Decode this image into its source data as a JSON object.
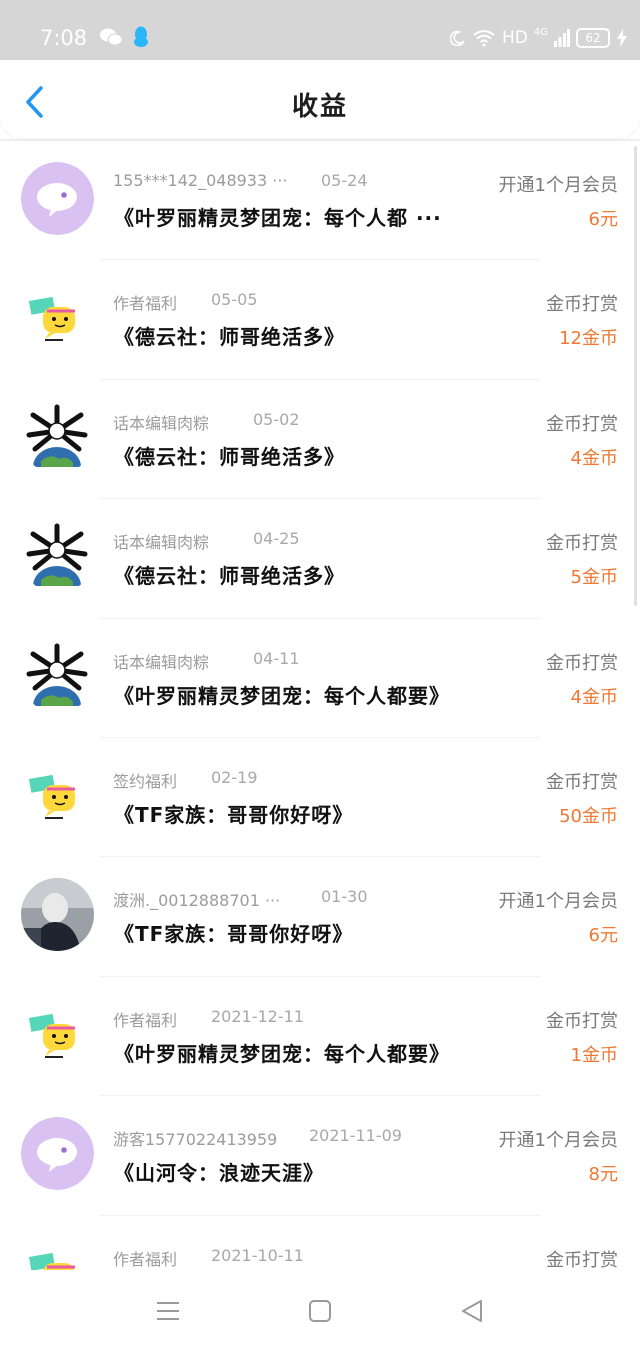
{
  "status_bar": {
    "time": "7:08",
    "hd": "HD",
    "network": "4G",
    "battery": "62",
    "icons": [
      "wechat-icon",
      "qq-icon",
      "moon-icon",
      "wifi-icon",
      "signal-icon",
      "battery-icon",
      "charging-icon"
    ]
  },
  "header": {
    "title": "收益",
    "back_icon": "chevron-left-icon"
  },
  "colors": {
    "accent": "#2196F3",
    "amount": "#F07832",
    "status_bar_bg": "#D6D6D6"
  },
  "records": [
    {
      "user": "155***142_048933 ···",
      "date": "05-24",
      "type": "开通1个月会员",
      "book": "《叶罗丽精灵梦团宠：每个人都 ···",
      "amount": "6元",
      "avatar": "chat-bubble-avatar"
    },
    {
      "user": "作者福利",
      "date": "05-05",
      "type": "金币打赏",
      "book": "《德云社：师哥绝活多》",
      "amount": "12金币",
      "avatar": "yellow-face-avatar"
    },
    {
      "user": "话本编辑肉粽",
      "date": "05-02",
      "type": "金币打赏",
      "book": "《德云社：师哥绝活多》",
      "amount": "4金币",
      "avatar": "earth-cartoon-avatar"
    },
    {
      "user": "话本编辑肉粽",
      "date": "04-25",
      "type": "金币打赏",
      "book": "《德云社：师哥绝活多》",
      "amount": "5金币",
      "avatar": "earth-cartoon-avatar"
    },
    {
      "user": "话本编辑肉粽",
      "date": "04-11",
      "type": "金币打赏",
      "book": "《叶罗丽精灵梦团宠：每个人都要》",
      "amount": "4金币",
      "avatar": "earth-cartoon-avatar"
    },
    {
      "user": "签约福利",
      "date": "02-19",
      "type": "金币打赏",
      "book": "《TF家族：哥哥你好呀》",
      "amount": "50金币",
      "avatar": "yellow-face-avatar"
    },
    {
      "user": "渡洲._0012888701 ···",
      "date": "01-30",
      "type": "开通1个月会员",
      "book": "《TF家族：哥哥你好呀》",
      "amount": "6元",
      "avatar": "photo-avatar"
    },
    {
      "user": "作者福利",
      "date": "2021-12-11",
      "type": "金币打赏",
      "book": "《叶罗丽精灵梦团宠：每个人都要》",
      "amount": "1金币",
      "avatar": "yellow-face-avatar"
    },
    {
      "user": "游客1577022413959",
      "date": "2021-11-09",
      "type": "开通1个月会员",
      "book": "《山河令：浪迹天涯》",
      "amount": "8元",
      "avatar": "chat-bubble-avatar"
    },
    {
      "user": "作者福利",
      "date": "2021-10-11",
      "type": "金币打赏",
      "book": "",
      "amount": "",
      "avatar": "yellow-face-avatar"
    }
  ],
  "nav_bar": {
    "icons": [
      "menu-icon",
      "home-square-icon",
      "back-triangle-icon"
    ]
  }
}
